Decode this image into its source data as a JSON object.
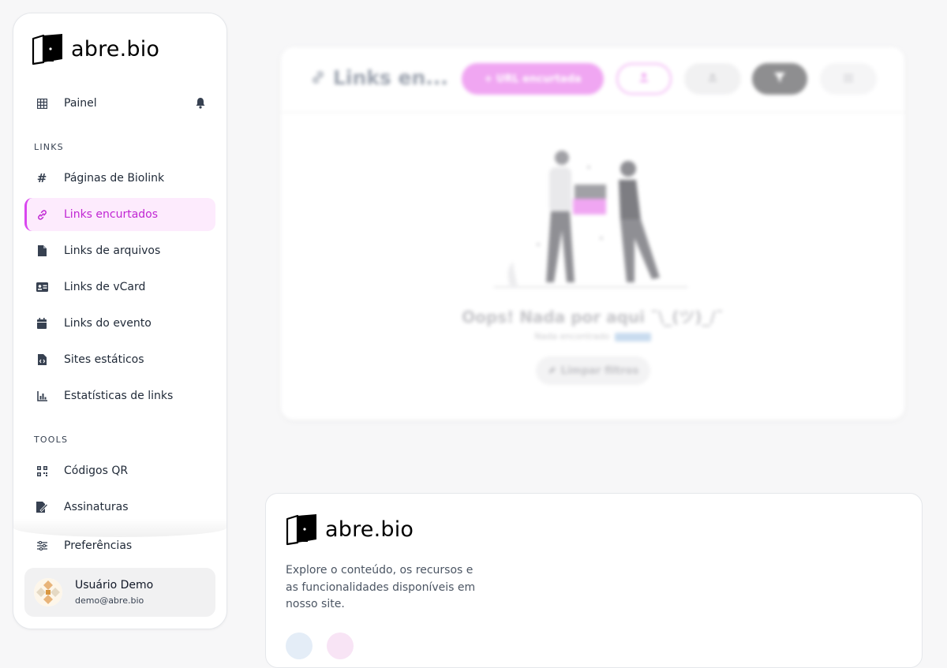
{
  "brand": {
    "name": "abre.bio"
  },
  "sidebar": {
    "dashboard": {
      "label": "Painel",
      "icon": "table-icon"
    },
    "sections": [
      {
        "label": "LINKS"
      },
      {
        "label": "TOOLS"
      }
    ],
    "links_items": [
      {
        "label": "Páginas de Biolink",
        "icon": "hash-icon"
      },
      {
        "label": "Links encurtados",
        "icon": "link-icon",
        "active": true
      },
      {
        "label": "Links de arquivos",
        "icon": "file-icon"
      },
      {
        "label": "Links de vCard",
        "icon": "id-card-icon"
      },
      {
        "label": "Links do evento",
        "icon": "calendar-icon"
      },
      {
        "label": "Sites estáticos",
        "icon": "file-code-icon"
      },
      {
        "label": "Estatísticas de links",
        "icon": "chart-icon"
      }
    ],
    "tools_items": [
      {
        "label": "Códigos QR",
        "icon": "qr-icon"
      },
      {
        "label": "Assinaturas",
        "icon": "signature-icon"
      }
    ],
    "preferences": {
      "label": "Preferências",
      "icon": "sliders-icon"
    },
    "user": {
      "name": "Usuário Demo",
      "email": "demo@abre.bio"
    }
  },
  "main": {
    "title": "Links en...",
    "add_button": "+ URL encurtada",
    "empty_title": "Oops! Nada por aqui ¯\\_(ツ)_/¯",
    "empty_subtitle": "Nada encontrado",
    "clear_filters": "Limpar filtros"
  },
  "footer": {
    "description": "Explore o conteúdo, os recursos e as funcionalidades disponíveis em nosso site."
  },
  "colors": {
    "accent": "#d946ef",
    "active_bg": "#fdebfd"
  }
}
